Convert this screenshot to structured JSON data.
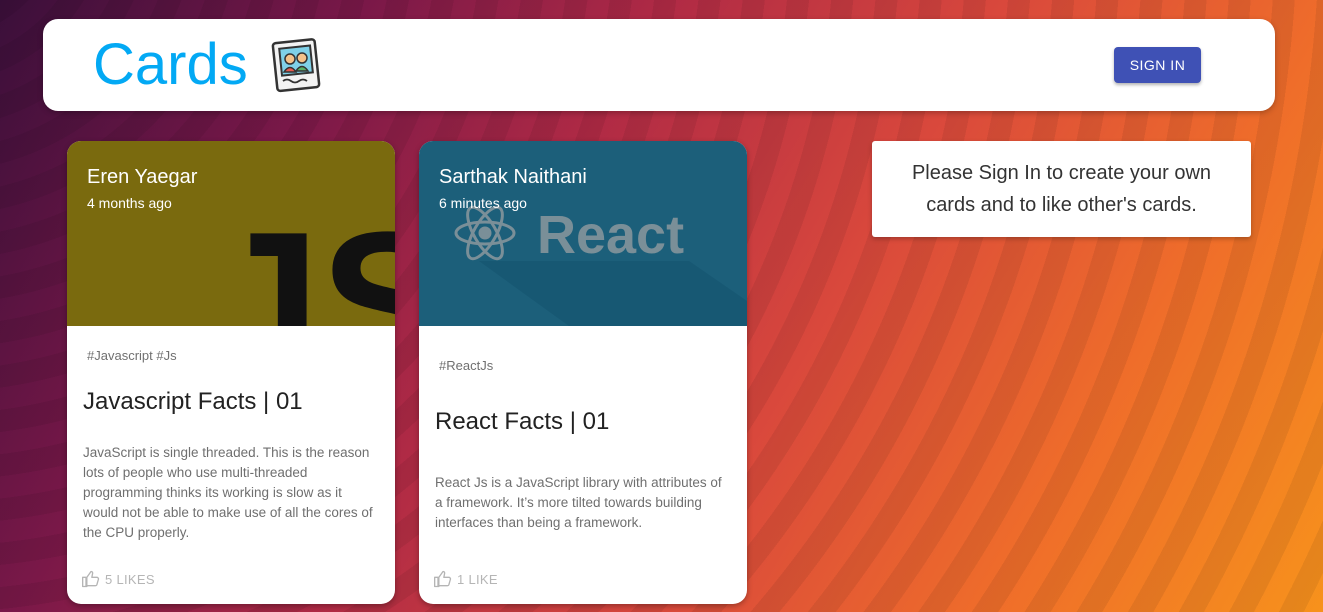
{
  "appbar": {
    "brand": "Cards",
    "brand_icon": "photo-frame-icon",
    "signin_label": "SIGN IN"
  },
  "cards": [
    {
      "author": "Eren Yaegar",
      "time": "4 months ago",
      "media_logo": "JS",
      "media_color": "#7a6a0e",
      "tags": "#Javascript #Js",
      "title": "Javascript Facts | 01",
      "description": "JavaScript is single threaded. This is the reason lots of people who use multi-threaded programming thinks its working is slow as it would not be able to make use of all the cores of the CPU properly.",
      "likes": "5 LIKES"
    },
    {
      "author": "Sarthak Naithani",
      "time": "6 minutes ago",
      "media_logo": "React",
      "media_color": "#1c5f7a",
      "tags": "#ReactJs",
      "title": "React Facts | 01",
      "description": "React Js is a JavaScript library with attributes of a framework. It’s more tilted towards building interfaces than being a framework.",
      "likes": "1 LIKE"
    }
  ],
  "signin_prompt": "Please Sign In to create your own cards and to like other's cards."
}
